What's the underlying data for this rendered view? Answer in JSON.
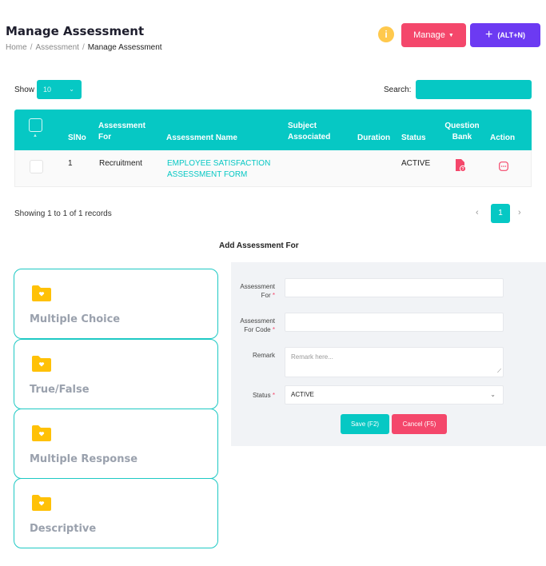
{
  "header": {
    "title": "Manage Assessment",
    "breadcrumb": [
      "Home",
      "Assessment",
      "Manage Assessment"
    ],
    "manage_label": "Manage",
    "add_label": "(ALT+N)",
    "info_glyph": "i"
  },
  "controls": {
    "show_label": "Show",
    "show_value": "10",
    "search_label": "Search:"
  },
  "table": {
    "columns": [
      {
        "key": "sino",
        "label": "SlNo"
      },
      {
        "key": "for",
        "label": "Assessment For"
      },
      {
        "key": "name",
        "label": "Assessment Name"
      },
      {
        "key": "subject",
        "label": "Subject Associated"
      },
      {
        "key": "duration",
        "label": "Duration"
      },
      {
        "key": "status",
        "label": "Status"
      },
      {
        "key": "bank",
        "label": "Question Bank"
      },
      {
        "key": "action",
        "label": "Action"
      }
    ],
    "rows": [
      {
        "sino": "1",
        "for": "Recruitment",
        "name": "EMPLOYEE SATISFACTION ASSESSMENT FORM",
        "subject": "",
        "duration": "",
        "status": "ACTIVE",
        "bank_icon": "question-file-icon",
        "action_icon": "more-options-icon"
      }
    ]
  },
  "pagination": {
    "records": "Showing 1 to 1 of 1 records",
    "prev": "‹",
    "current": "1",
    "next": "›"
  },
  "form": {
    "section_title": "Add Assessment For",
    "assessment_for_label": "Assessment For",
    "code_label": "Assessment For Code",
    "remark_label": "Remark",
    "remark_placeholder": "Remark here...",
    "status_label": "Status",
    "status_value": "ACTIVE",
    "required_mark": "*",
    "save_label": "Save (F2)",
    "cancel_label": "Cancel (F5)"
  },
  "question_types": [
    {
      "label": "Multiple Choice",
      "icon": "folder-icon"
    },
    {
      "label": "True/False",
      "icon": "folder-icon"
    },
    {
      "label": "Multiple Response",
      "icon": "folder-icon"
    },
    {
      "label": "Descriptive",
      "icon": "folder-icon"
    }
  ],
  "colors": {
    "teal": "#06c8c4",
    "pink": "#f4476b",
    "purple": "#6c3af2",
    "folder_yellow": "#ffc107"
  }
}
